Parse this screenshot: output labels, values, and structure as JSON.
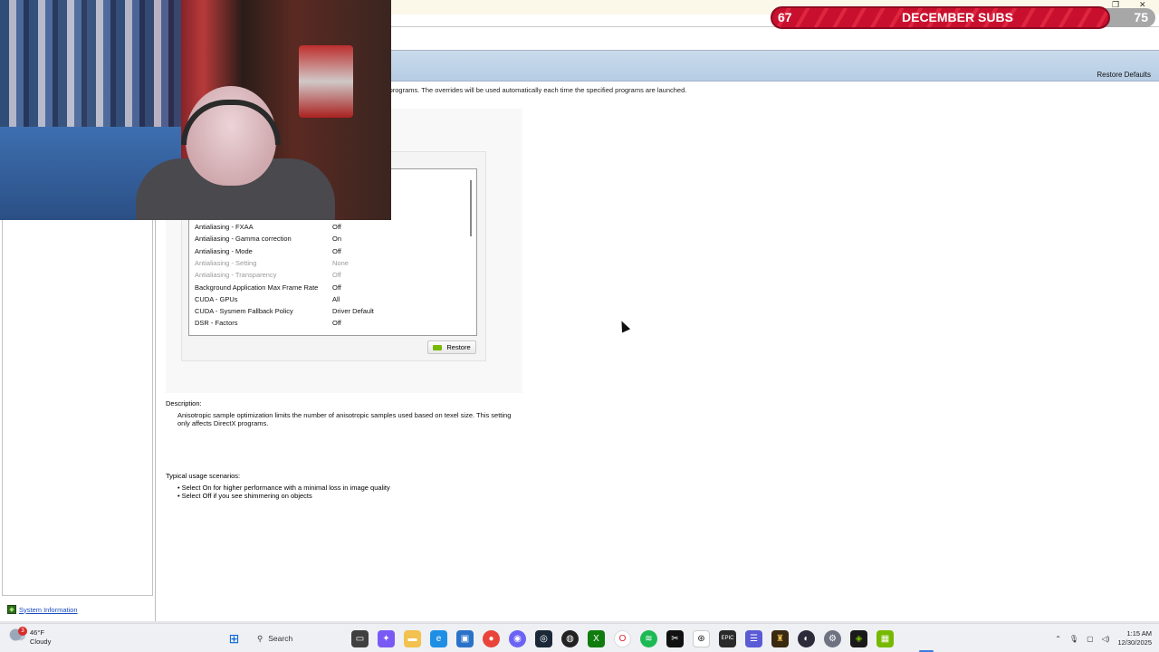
{
  "header": {
    "restore_defaults": "Restore Defaults",
    "intro_text": "fic programs. The overrides will be used automatically each time the specified programs are launched."
  },
  "settings_list": [
    {
      "feature": "Antialiasing - FXAA",
      "value": "Off",
      "disabled": false
    },
    {
      "feature": "Antialiasing - Gamma correction",
      "value": "On",
      "disabled": false
    },
    {
      "feature": "Antialiasing - Mode",
      "value": "Off",
      "disabled": false
    },
    {
      "feature": "Antialiasing - Setting",
      "value": "None",
      "disabled": true
    },
    {
      "feature": "Antialiasing - Transparency",
      "value": "Off",
      "disabled": true
    },
    {
      "feature": "Background Application Max Frame Rate",
      "value": "Off",
      "disabled": false
    },
    {
      "feature": "CUDA - GPUs",
      "value": "All",
      "disabled": false
    },
    {
      "feature": "CUDA - Sysmem Fallback Policy",
      "value": "Driver Default",
      "disabled": false
    },
    {
      "feature": "DSR - Factors",
      "value": "Off",
      "disabled": false
    }
  ],
  "restore_button": "Restore",
  "description": {
    "label": "Description:",
    "text": "Anisotropic sample optimization limits the number of anisotropic samples used based on texel size. This setting only affects DirectX programs."
  },
  "usage": {
    "label": "Typical usage scenarios:",
    "items": [
      "Select On for higher performance with a minimal loss in image quality",
      "Select Off if you see shimmering on objects"
    ]
  },
  "sidebar": {
    "system_information": "System Information"
  },
  "overlay": {
    "current": "67",
    "title": "DECEMBER SUBS",
    "goal": "75"
  },
  "taskbar": {
    "weather_temp": "46°F",
    "weather_cond": "Cloudy",
    "weather_badge": "3",
    "search_label": "Search",
    "time": "1:15 AM",
    "date": "12/30/2025",
    "colors": {
      "accent": "#3b7be0",
      "nvidia": "#76b900"
    }
  }
}
